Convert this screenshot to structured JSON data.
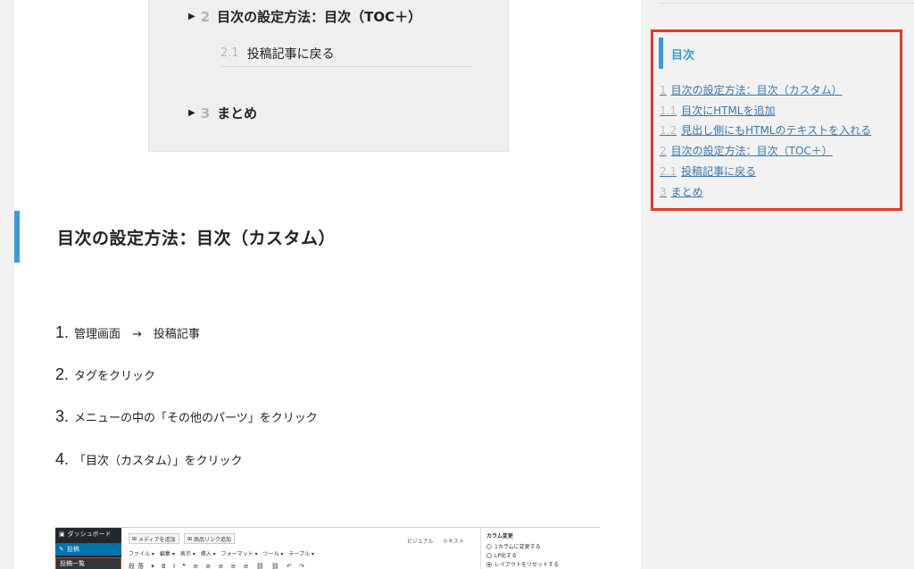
{
  "toc": {
    "items": [
      {
        "num": "2",
        "label": "目次の設定方法：目次（TOC＋）"
      },
      {
        "num": "3",
        "label": "まとめ"
      }
    ],
    "sub": {
      "num": "2.1",
      "label": "投稿記事に戻る"
    }
  },
  "section_heading": "目次の設定方法：目次（カスタム）",
  "steps": [
    {
      "num": "1.",
      "text": "管理画面　→　投稿記事"
    },
    {
      "num": "2.",
      "text": "タグをクリック"
    },
    {
      "num": "3.",
      "text": "メニューの中の「その他のパーツ」をクリック"
    },
    {
      "num": "4.",
      "text": "「目次（カスタム）」をクリック"
    }
  ],
  "editor": {
    "sidebar": {
      "dashboard": "ダッシュボード",
      "posts": "投稿",
      "all_posts": "投稿一覧"
    },
    "add_media": "メディアを追加",
    "product_link": "商品リンク追加",
    "tab_visual": "ビジュアル",
    "tab_text": "テキスト",
    "menu": "ファイル ▾　編集 ▾　表示 ▾　挿入 ▾　フォーマット ▾　ツール ▾　テーブル ▾",
    "toolbar": "段落 ▾ B I ❝ ≡ ≡ ≡ ≡ ≡ ⛓ ⛓ ↶ ↷",
    "right_panel": {
      "title": "カラム変更",
      "options": [
        "1カラムに変更する",
        "LP化する",
        "レイアウトをリセットする"
      ]
    }
  },
  "sidebar_widget": {
    "title": "目次",
    "links": [
      {
        "num": "1",
        "label": "目次の設定方法：目次（カスタム）"
      },
      {
        "num": "1.1",
        "label": "目次にHTMLを追加"
      },
      {
        "num": "1.2",
        "label": "見出し側にもHTMLのテキストを入れる"
      },
      {
        "num": "2",
        "label": "目次の設定方法：目次（TOC＋）"
      },
      {
        "num": "2.1",
        "label": "投稿記事に戻る"
      },
      {
        "num": "3",
        "label": "まとめ"
      }
    ]
  },
  "colors": {
    "accent": "#3a9ad9",
    "highlight_border": "#e23b25",
    "link": "#3a78b0"
  }
}
